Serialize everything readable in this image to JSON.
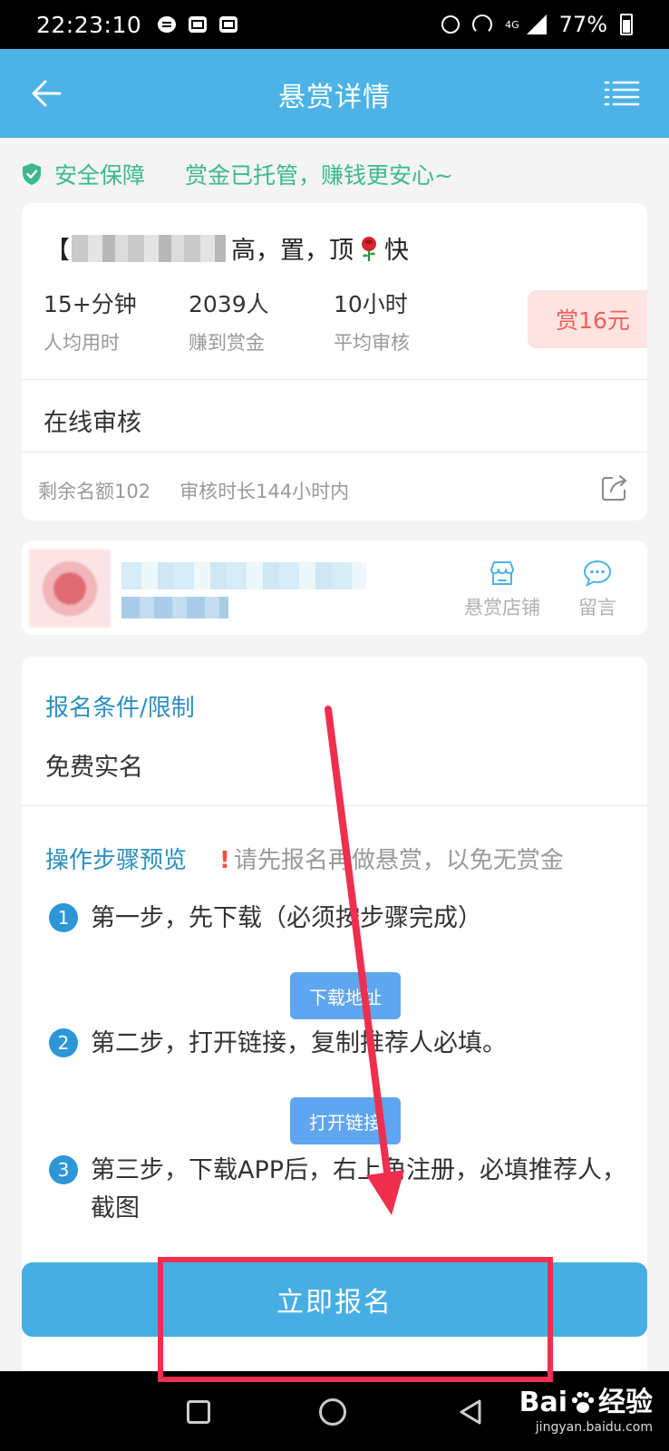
{
  "status_bar": {
    "time": "22:23:10",
    "network": "4G",
    "battery": "77%"
  },
  "header": {
    "title": "悬赏详情"
  },
  "safety": {
    "label": "安全保障",
    "message": "赏金已托管，赚钱更安心~"
  },
  "task": {
    "title_prefix": "【",
    "title_suffix": "高，置，顶",
    "title_end": "快",
    "stats": [
      {
        "value": "15+分钟",
        "label": "人均用时"
      },
      {
        "value": "2039人",
        "label": "赚到赏金"
      },
      {
        "value": "10小时",
        "label": "平均审核"
      }
    ],
    "reward": "赏16元",
    "review_mode": "在线审核",
    "remaining": "剩余名额102",
    "review_window": "审核时长144小时内"
  },
  "store": {
    "shop_label": "悬赏店铺",
    "message_label": "留言"
  },
  "conditions": {
    "title": "报名条件/限制",
    "value": "免费实名"
  },
  "steps_section": {
    "title": "操作步骤预览",
    "warning_mark": "!",
    "warning": "请先报名再做悬赏，以免无赏金",
    "steps": [
      {
        "num": "1",
        "text": "第一步，先下载（必须按步骤完成）",
        "button": "下载地址"
      },
      {
        "num": "2",
        "text": "第二步，打开链接，复制推荐人必填。",
        "button": "打开链接"
      },
      {
        "num": "3",
        "text": "第三步，下载APP后，右上角注册，必填推荐人，截图"
      }
    ]
  },
  "signup": {
    "label": "立即报名"
  },
  "watermark": {
    "brand_left": "Bai",
    "brand_right": "经验",
    "url": "jingyan.baidu.com"
  },
  "colors": {
    "header_bg": "#4db3e6",
    "safety_green": "#3bb98b",
    "section_blue": "#2c8fc0",
    "reward_red": "#f0605a",
    "reward_bg": "#fde4e1",
    "annotation_red": "#ee2f4e"
  }
}
